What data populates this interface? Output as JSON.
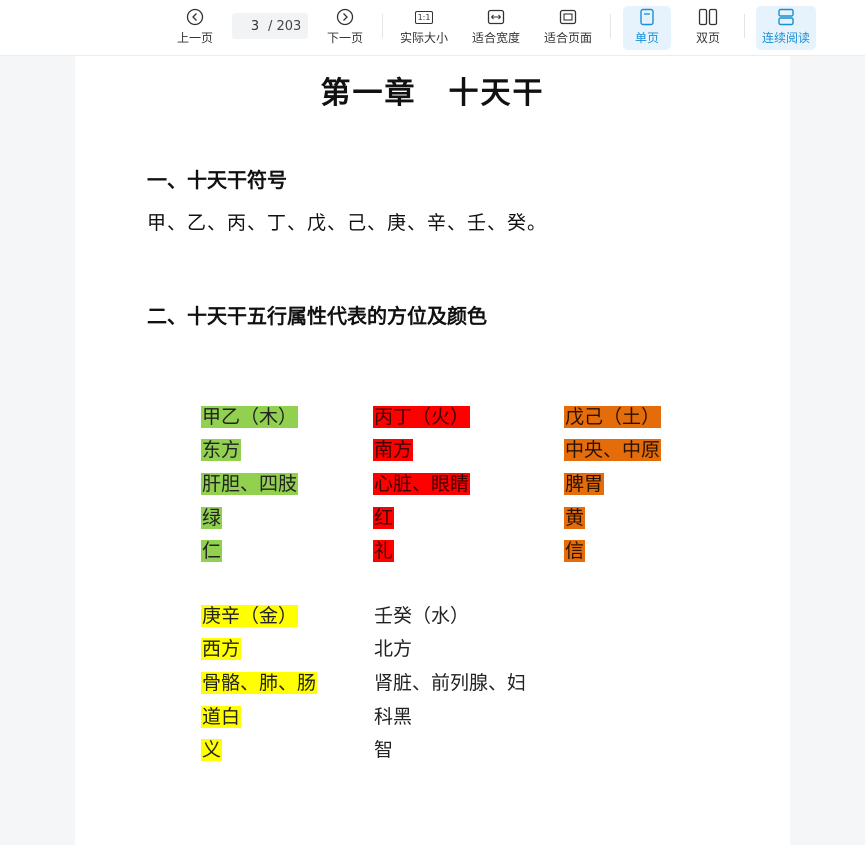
{
  "toolbar": {
    "prev_label": "上一页",
    "current_page": "3",
    "total_pages": "/ 203",
    "next_label": "下一页",
    "actual_size_label": "实际大小",
    "actual_size_icon_text": "1:1",
    "fit_width_label": "适合宽度",
    "fit_page_label": "适合页面",
    "single_page_label": "单页",
    "double_page_label": "双页",
    "continuous_label": "连续阅读",
    "accent_color": "#1a8fd6"
  },
  "document": {
    "title": "第一章　十天干",
    "section1": {
      "heading": "一、十天干符号",
      "text": "甲、乙、丙、丁、戊、己、庚、辛、壬、癸。"
    },
    "section2": {
      "heading": "二、十天干五行属性代表的方位及颜色"
    },
    "groups": {
      "wood": [
        "甲乙（木）",
        "东方",
        "肝胆、四肢",
        "绿",
        "仁"
      ],
      "fire": [
        "丙丁（火）",
        "南方",
        "心脏、眼睛",
        "红",
        "礼"
      ],
      "earth": [
        "戊己（土）",
        "中央、中原",
        "脾胃",
        "黄",
        "信"
      ],
      "metal": [
        "庚辛（金）",
        "西方",
        "骨骼、肺、肠",
        "道白",
        "义"
      ],
      "water": [
        "壬癸（水）",
        "北方",
        "肾脏、前列腺、妇",
        "科黑",
        "智"
      ]
    },
    "highlight_colors": {
      "wood": "#92d050",
      "fire": "#ff0000",
      "earth": "#e46c0a",
      "metal": "#ffff00"
    }
  }
}
